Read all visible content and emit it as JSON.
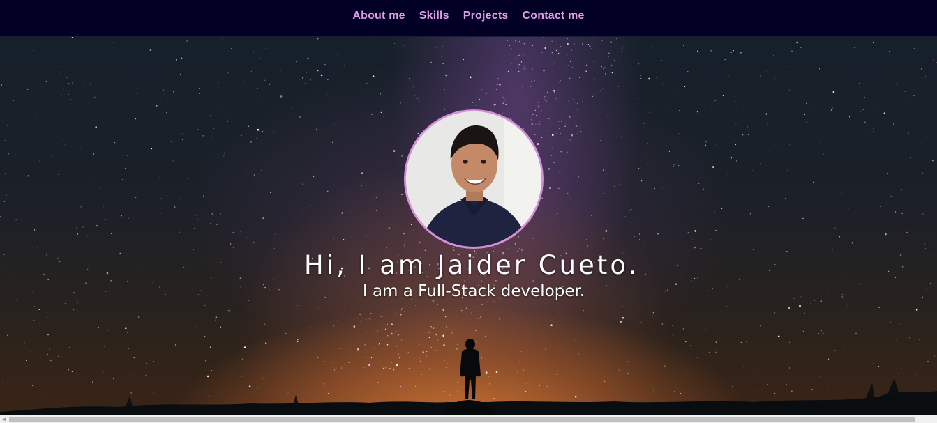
{
  "nav": {
    "items": [
      {
        "label": "About me"
      },
      {
        "label": "Skills"
      },
      {
        "label": "Projects"
      },
      {
        "label": "Contact me"
      }
    ]
  },
  "hero": {
    "title": "Hi, I am Jaider Cueto.",
    "subtitle": "I am a Full-Stack developer."
  },
  "colors": {
    "nav_background": "#020024",
    "nav_link": "#e29ce8",
    "avatar_border": "#d58ed8",
    "text": "#ffffff"
  },
  "icons": {
    "scroll_left": "scroll-left-arrow-icon"
  }
}
